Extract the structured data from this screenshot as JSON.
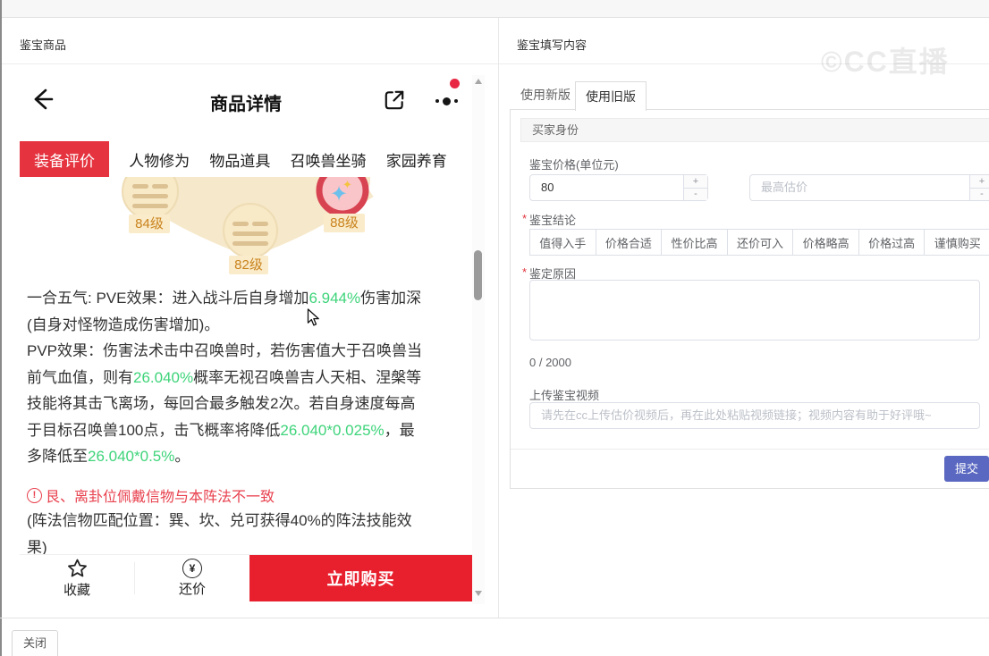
{
  "page": {
    "left_section_title": "鉴宝商品",
    "right_section_title": "鉴宝填写内容",
    "close_button": "关闭",
    "watermark": "©CC直播"
  },
  "product": {
    "title": "商品详情",
    "tabs": [
      "装备评价",
      "人物修为",
      "物品道具",
      "召唤兽坐骑",
      "家园养育"
    ],
    "active_tab": "装备评价",
    "badges": {
      "b84": "84级",
      "b82": "82级",
      "b88": "88级"
    },
    "description_lines": [
      [
        {
          "t": "一合五气: PVE效果：进入战斗后自身增加"
        },
        {
          "t": "6.944%",
          "c": "g"
        },
        {
          "t": "伤害加深"
        }
      ],
      [
        {
          "t": "(自身对怪物造成伤害增加)。"
        }
      ],
      [
        {
          "t": "PVP效果：伤害法术击中召唤兽时，若伤害值大于召唤兽当"
        }
      ],
      [
        {
          "t": "前气血值，则有"
        },
        {
          "t": "26.040%",
          "c": "g"
        },
        {
          "t": "概率无视召唤兽吉人天相、涅槃等"
        }
      ],
      [
        {
          "t": "技能将其击飞离场，每回合最多触发2次。若自身速度每高"
        }
      ],
      [
        {
          "t": "于目标召唤兽100点，击飞概率将降低"
        },
        {
          "t": "26.040*0.025%",
          "c": "g"
        },
        {
          "t": "，最"
        }
      ],
      [
        {
          "t": "多降低至"
        },
        {
          "t": "26.040*0.5%",
          "c": "g"
        },
        {
          "t": "。"
        }
      ]
    ],
    "warning_icon": "!",
    "warning": "艮、离卦位佩戴信物与本阵法不一致",
    "note_lines": [
      [
        {
          "t": "(阵法信物匹配位置：巽、坎、兑可获得40%的阵法技能效"
        }
      ],
      [
        {
          "t": "果)"
        }
      ]
    ],
    "actions": {
      "favorite": "收藏",
      "bargain": "还价",
      "bargain_symbol": "¥",
      "buy": "立即购买"
    }
  },
  "form": {
    "tab_new": "使用新版",
    "tab_old": "使用旧版",
    "buyer_identity": "买家身份",
    "price_label": "鉴宝价格(单位元)",
    "price_value": "80",
    "max_price_placeholder": "最高估价",
    "stepper_plus": "+",
    "stepper_minus": "-",
    "conclusion_label": "鉴宝结论",
    "conclusion_options": [
      "值得入手",
      "价格合适",
      "性价比高",
      "还价可入",
      "价格略高",
      "价格过高",
      "谨慎购买"
    ],
    "reason_label": "鉴定原因",
    "char_counter": "0 / 2000",
    "video_label": "上传鉴宝视频",
    "video_placeholder": "请先在cc上传估价视频后，再在此处粘贴视频链接；视频内容有助于好评哦~",
    "submit": "提交"
  },
  "colors": {
    "tab_red": "#e5333f",
    "buy_red": "#e8202e",
    "green_highlight": "#3ed47a",
    "warning_red": "#e8414e",
    "submit_indigo": "#5a68c1",
    "badge_cream": "#f6e8ca",
    "badge_label_bg": "#faecca",
    "badge_label_text": "#c9821d"
  }
}
